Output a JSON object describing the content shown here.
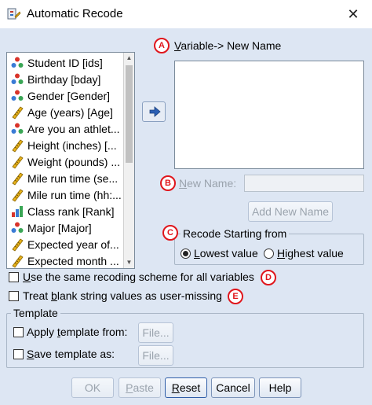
{
  "window": {
    "title": "Automatic Recode",
    "close_glyph": "✕"
  },
  "variables": [
    {
      "label": "Student ID [ids]",
      "icon": "nominal-icon"
    },
    {
      "label": "Birthday [bday]",
      "icon": "nominal-icon"
    },
    {
      "label": "Gender [Gender]",
      "icon": "nominal-icon"
    },
    {
      "label": "Age (years) [Age]",
      "icon": "scale-icon"
    },
    {
      "label": "Are you an athlet...",
      "icon": "nominal-icon"
    },
    {
      "label": "Height (inches) [...",
      "icon": "scale-icon"
    },
    {
      "label": "Weight (pounds) ...",
      "icon": "scale-icon"
    },
    {
      "label": "Mile run time (se...",
      "icon": "scale-icon"
    },
    {
      "label": "Mile run time (hh:...",
      "icon": "scale-icon"
    },
    {
      "label": "Class rank [Rank]",
      "icon": "ordinal-icon"
    },
    {
      "label": "Major [Major]",
      "icon": "nominal-icon"
    },
    {
      "label": "Expected year of...",
      "icon": "scale-icon"
    },
    {
      "label": "Expected month ...",
      "icon": "scale-icon"
    }
  ],
  "annotations": {
    "a": "A",
    "b": "B",
    "c": "C",
    "d": "D",
    "e": "E"
  },
  "variable_new_name": {
    "label_underlined": "V",
    "label_rest": "ariable-> New Name"
  },
  "new_name": {
    "label_underlined": "N",
    "label_rest": "ew Name:",
    "value": "",
    "add_button": "Add New Name"
  },
  "recode_group": {
    "title": "Recode Starting from",
    "lowest_u": "L",
    "lowest_rest": "owest value",
    "highest_u": "H",
    "highest_rest": "ighest value",
    "selected": "lowest"
  },
  "options": {
    "same_scheme_u": "U",
    "same_scheme_rest": "se the same recoding scheme for all variables",
    "same_scheme_checked": false,
    "blank_pre": "Treat ",
    "blank_u": "b",
    "blank_rest": "lank string values as user-missing",
    "blank_checked": false
  },
  "template_group": {
    "title": "Template",
    "apply_pre": "Apply ",
    "apply_u": "t",
    "apply_rest": "emplate from:",
    "apply_checked": false,
    "save_u": "S",
    "save_rest": "ave template as:",
    "save_checked": false,
    "file_button": "File..."
  },
  "buttons": {
    "ok": "OK",
    "paste_u": "P",
    "paste_rest": "aste",
    "reset_u": "R",
    "reset_rest": "eset",
    "cancel": "Cancel",
    "help": "Help"
  },
  "colors": {
    "dialog_bg": "#dde6f3",
    "annotation_red": "#e0161c",
    "disabled_text": "#9aa3ad"
  }
}
